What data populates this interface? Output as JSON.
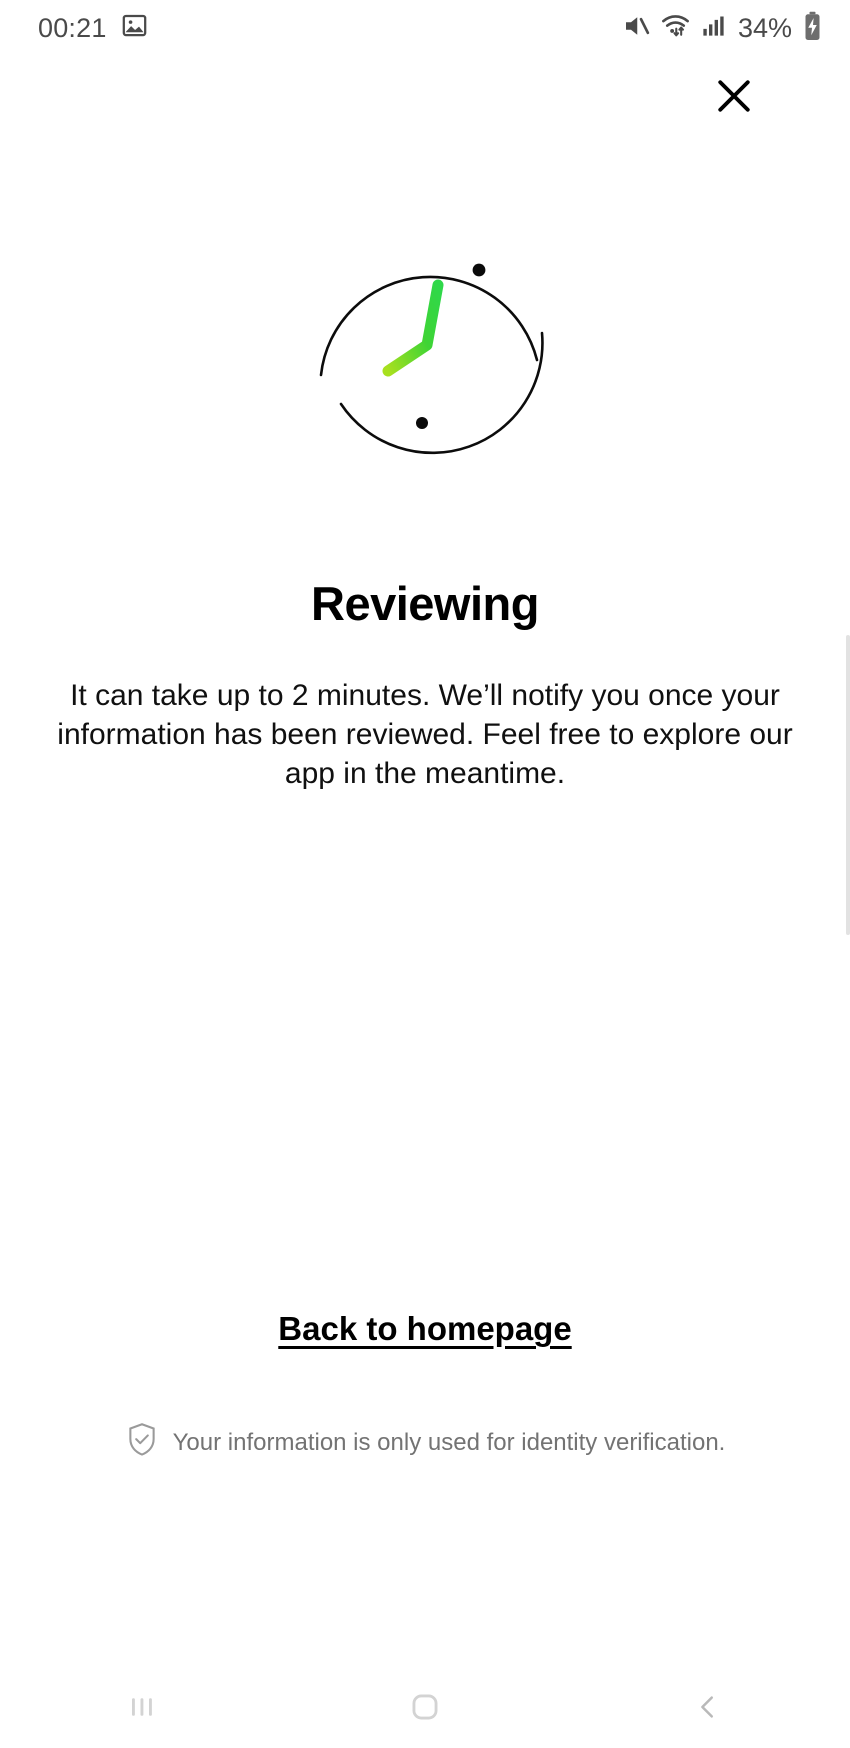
{
  "status_bar": {
    "time": "00:21",
    "battery_percent": "34%",
    "icons": {
      "gallery": "image-icon",
      "mute": "volume-muted-icon",
      "wifi": "wifi-icon",
      "signal": "cellular-signal-icon",
      "battery": "battery-charging-icon"
    }
  },
  "header": {
    "close_icon": "close-icon"
  },
  "illustration": {
    "name": "clock-loader-illustration",
    "ring_color": "#000000",
    "dot_color": "#0a0a0a",
    "hand_gradient_start": "#00c853",
    "hand_gradient_end": "#a8e01e"
  },
  "main": {
    "title": "Reviewing",
    "description": "It can take up to 2 minutes. We’ll notify you once your information has been reviewed. Feel free to explore our app in the meantime."
  },
  "actions": {
    "back_home_label": "Back to homepage"
  },
  "footer": {
    "shield_icon": "shield-check-icon",
    "note": "Your information is only used for identity verification."
  },
  "navigation_bar": {
    "recents": "recents-icon",
    "home": "home-icon",
    "back": "back-icon"
  },
  "colors": {
    "background": "#ffffff",
    "text_primary": "#000000",
    "text_muted": "#737373",
    "accent_green": "#32d74b"
  }
}
